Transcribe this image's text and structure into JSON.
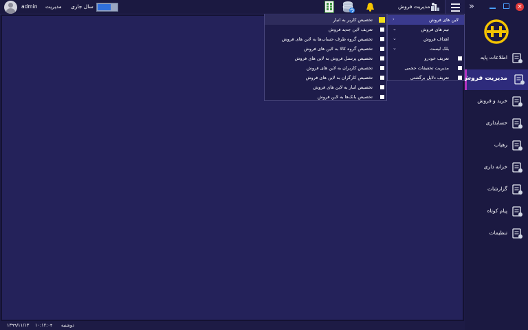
{
  "topbar": {
    "user_name": "admin",
    "role": "مدیریت",
    "year_label": "سال جاری",
    "module_title": "مدیریت فروش"
  },
  "sidebar": {
    "items": [
      {
        "label": "اطلاعات پایه",
        "icon": "basic-info-icon"
      },
      {
        "label": "مدیریت فروش",
        "icon": "sales-management-icon",
        "active": true
      },
      {
        "label": "خرید و فروش",
        "icon": "buy-sell-icon"
      },
      {
        "label": "حسابداری",
        "icon": "accounting-icon"
      },
      {
        "label": "رهیاب",
        "icon": "tracker-icon"
      },
      {
        "label": "خزانه داری",
        "icon": "treasury-icon"
      },
      {
        "label": "گزارشات",
        "icon": "reports-icon"
      },
      {
        "label": "پیام کوتاه",
        "icon": "sms-icon"
      },
      {
        "label": "تنظیمات",
        "icon": "settings-icon"
      }
    ]
  },
  "menu_right": {
    "items": [
      {
        "label": "لاین های فروش",
        "type": "expanded"
      },
      {
        "label": "تیم های فروش",
        "type": "collapsible"
      },
      {
        "label": "اهداف فروش",
        "type": "collapsible"
      },
      {
        "label": "بلک لیست",
        "type": "collapsible"
      },
      {
        "label": "تعریف خودرو",
        "type": "leaf"
      },
      {
        "label": "مدیریت تخفیفات حجمی",
        "type": "leaf"
      },
      {
        "label": "تعریف دلایل برگشتی",
        "type": "leaf"
      }
    ]
  },
  "menu_sub": {
    "items": [
      {
        "label": "تخصیص کاربر به انبار",
        "selected": true
      },
      {
        "label": "تعریف لاین جدید فروش"
      },
      {
        "label": "تخصیص گروه طرف حساب‌ها به لاین های فروش"
      },
      {
        "label": "تخصیص گروه کالا به لاین های فروش"
      },
      {
        "label": "تخصیص پرسنل فروش به لاین های فروش"
      },
      {
        "label": "تخصیص کاربران به لاین های فروش"
      },
      {
        "label": "تخصیص کارگران به لاین های فروش"
      },
      {
        "label": "تخصیص انبار به لاین های فروش"
      },
      {
        "label": "تخصیص بانک‌ها به لاین فروش"
      }
    ]
  },
  "statusbar": {
    "date": "۱۳۹۹/۱۱/۱۳",
    "time": "۱۰:۱۲:۰۴",
    "weekday": "دوشنبه"
  },
  "colors": {
    "background": "#1d1b45",
    "panel": "#24225a",
    "active_nav": "#2e2b7c",
    "active_accent": "#b532c0",
    "selected_checkbox": "#f3e01a",
    "logo": "#f5c400",
    "close": "#e03a3a"
  }
}
